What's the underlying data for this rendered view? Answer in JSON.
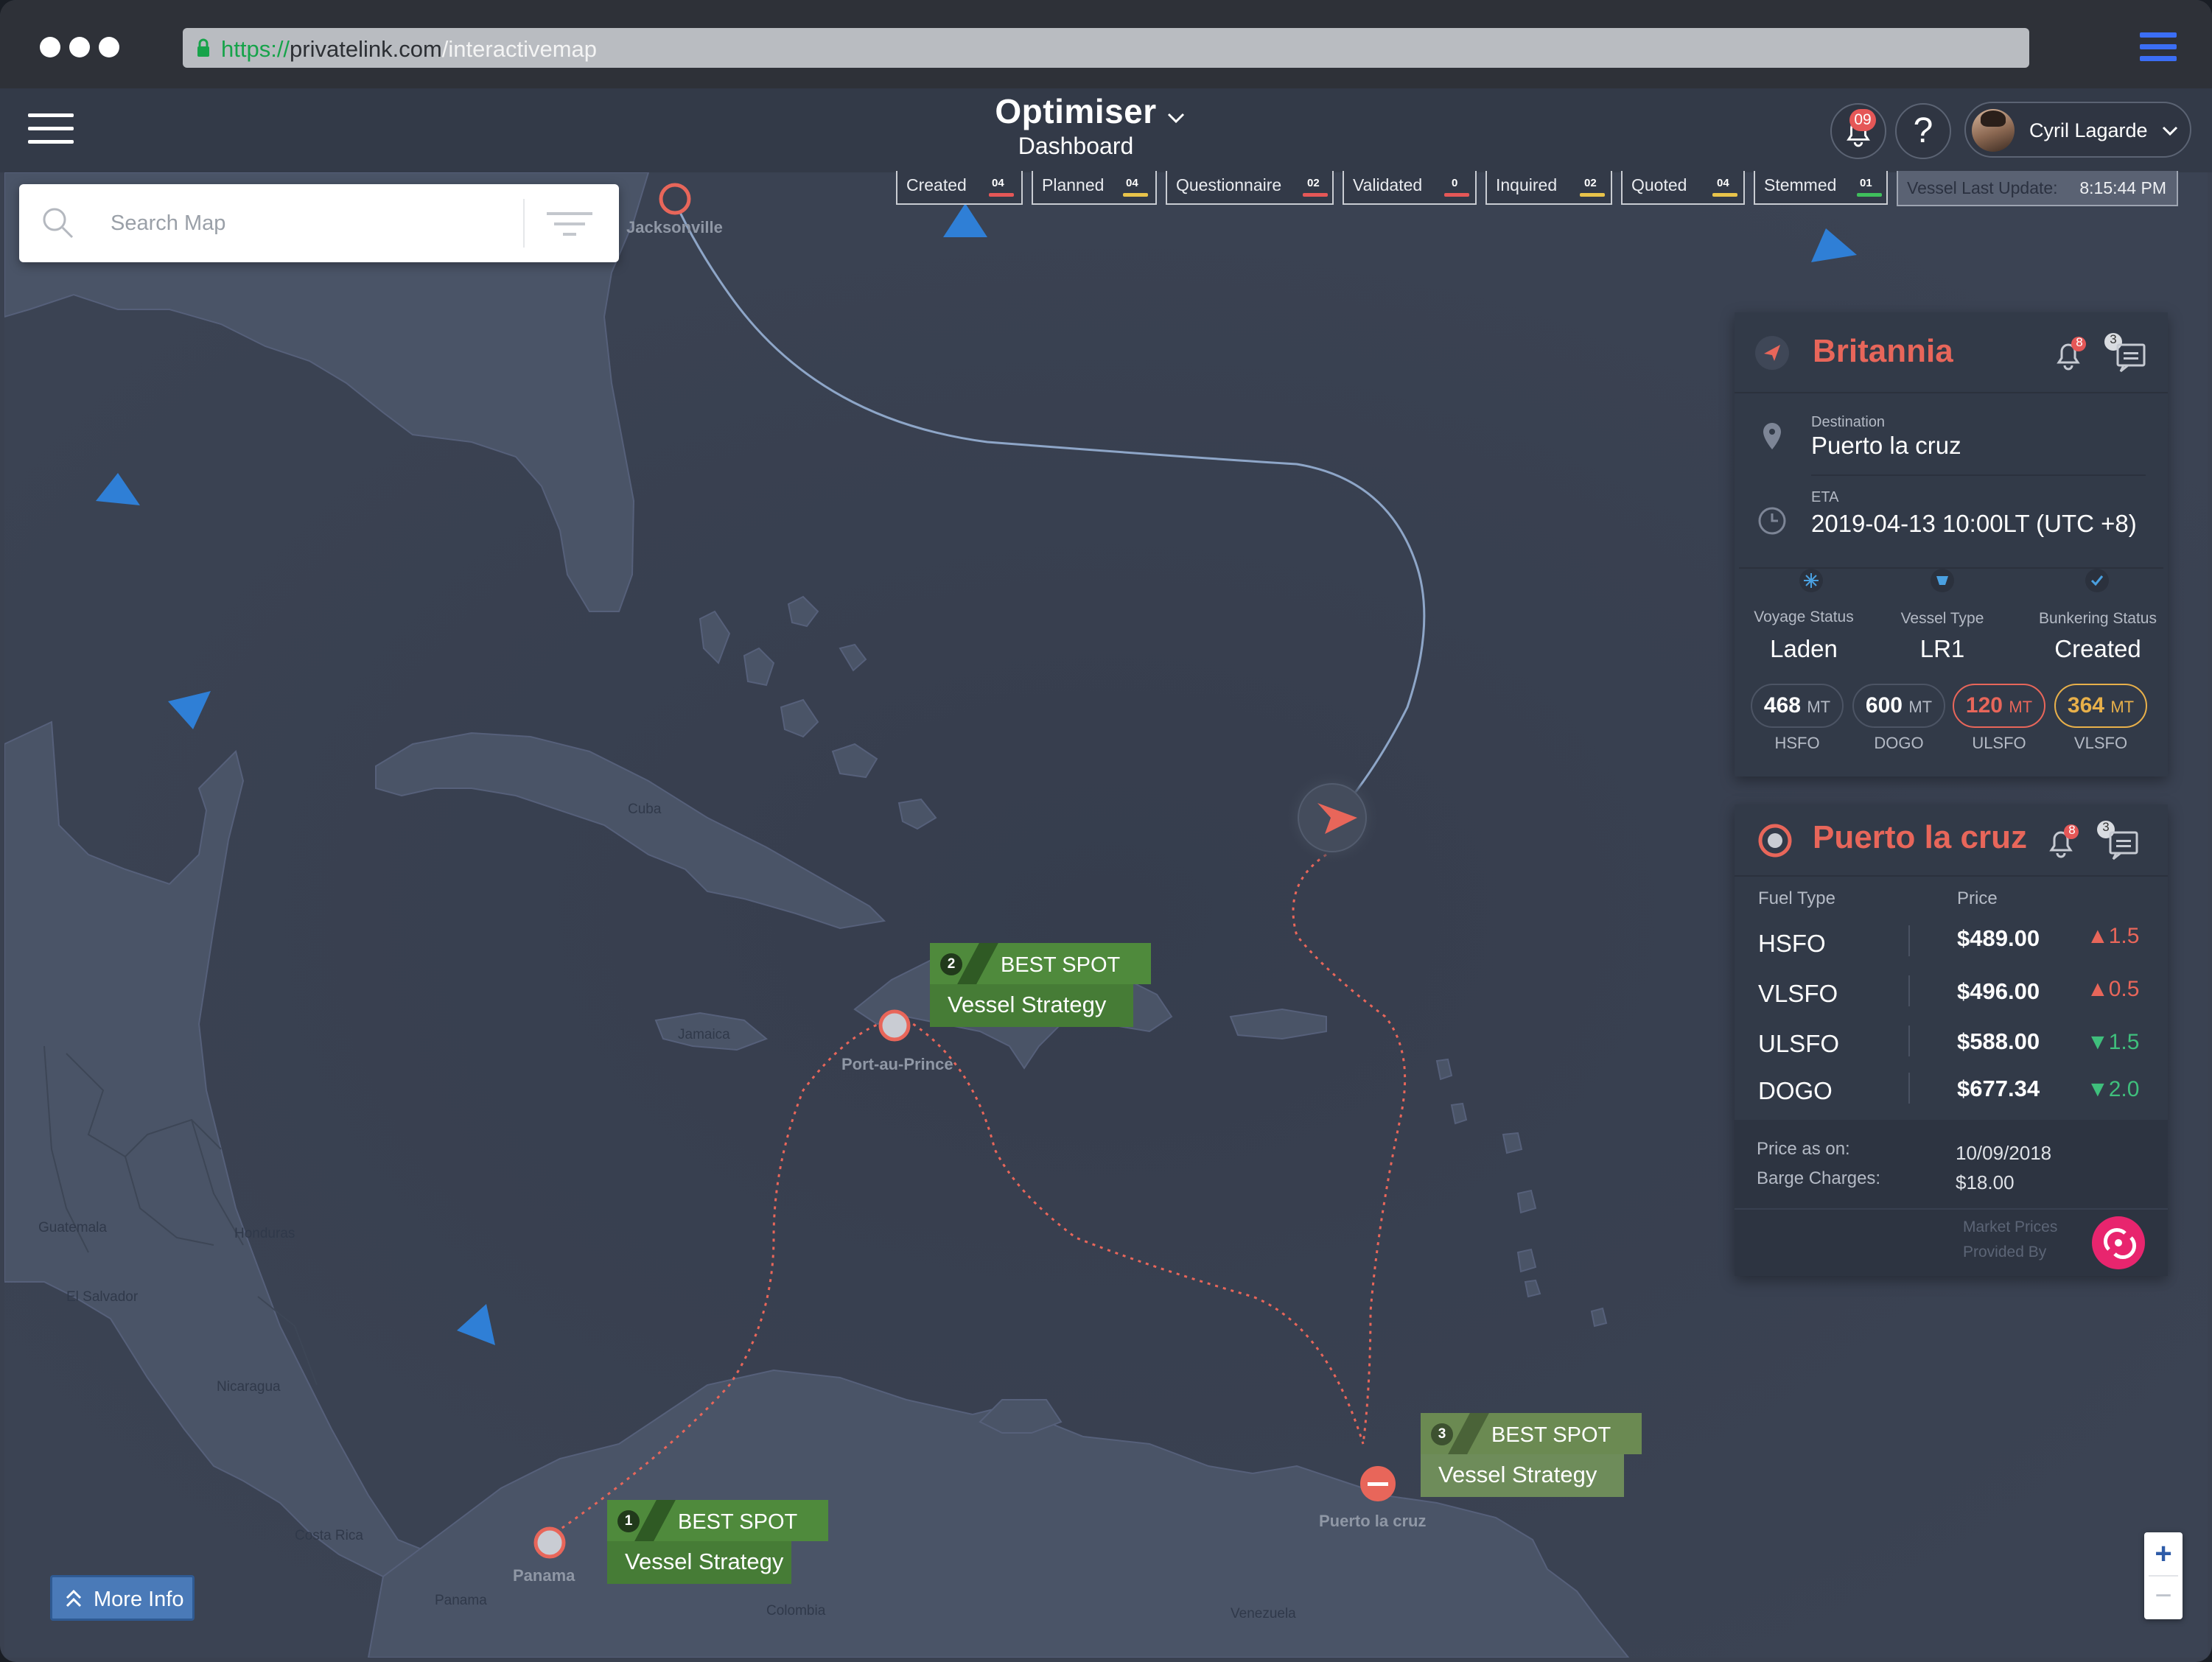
{
  "browser": {
    "url_scheme": "https://",
    "url_host": "privatelink.com",
    "url_path": "/interactivemap"
  },
  "app": {
    "title": "Optimiser",
    "subtitle": "Dashboard",
    "notifications_count": "09",
    "help_label": "?",
    "user_name": "Cyril Lagarde"
  },
  "search": {
    "placeholder": "Search Map"
  },
  "status_tabs": [
    {
      "label": "Created",
      "count": "04",
      "color": "#e55757"
    },
    {
      "label": "Planned",
      "count": "04",
      "color": "#e8c34a"
    },
    {
      "label": "Questionnaire",
      "count": "02",
      "color": "#e55757"
    },
    {
      "label": "Validated",
      "count": "0",
      "color": "#e55757"
    },
    {
      "label": "Inquired",
      "count": "02",
      "color": "#e8c34a"
    },
    {
      "label": "Quoted",
      "count": "04",
      "color": "#e8c34a"
    },
    {
      "label": "Stemmed",
      "count": "01",
      "color": "#3fbf5c"
    }
  ],
  "vessel_update": {
    "label": "Vessel Last Update:",
    "time": "8:15:44 PM"
  },
  "map": {
    "cities": [
      "Jacksonville",
      "Port-au-Prince",
      "Panama",
      "Puerto la cruz"
    ],
    "regions": [
      "Cuba",
      "Jamaica",
      "Guatemala",
      "Honduras",
      "El Salvador",
      "Nicaragua",
      "Costa Rica",
      "Panama",
      "Colombia",
      "Venezuela"
    ]
  },
  "best_spots": [
    {
      "number": "1",
      "title": "BEST SPOT",
      "label": "Vessel Strategy"
    },
    {
      "number": "2",
      "title": "BEST SPOT",
      "label": "Vessel Strategy"
    },
    {
      "number": "3",
      "title": "BEST SPOT",
      "label": "Vessel Strategy"
    }
  ],
  "vessel": {
    "name": "Britannia",
    "alerts": "8",
    "messages": "3",
    "destination_label": "Destination",
    "destination": "Puerto la cruz",
    "eta_label": "ETA",
    "eta": "2019-04-13 10:00LT (UTC +8)",
    "voyage_status_label": "Voyage Status",
    "voyage_status": "Laden",
    "vessel_type_label": "Vessel Type",
    "vessel_type": "LR1",
    "bunkering_status_label": "Bunkering Status",
    "bunkering_status": "Created",
    "fuels": [
      {
        "amount": "468",
        "unit": "MT",
        "name": "HSFO",
        "color": "#ffffff",
        "border": "#4c5464"
      },
      {
        "amount": "600",
        "unit": "MT",
        "name": "DOGO",
        "color": "#ffffff",
        "border": "#4c5464"
      },
      {
        "amount": "120",
        "unit": "MT",
        "name": "ULSFO",
        "color": "#e8665a",
        "border": "#e8665a"
      },
      {
        "amount": "364",
        "unit": "MT",
        "name": "VLSFO",
        "color": "#e8b04a",
        "border": "#e8b04a"
      }
    ]
  },
  "port": {
    "name": "Puerto la cruz",
    "alerts": "8",
    "messages": "3",
    "col_fuel": "Fuel Type",
    "col_price": "Price",
    "prices": [
      {
        "fuel": "HSFO",
        "price": "$489.00",
        "change": "1.5",
        "direction": "up"
      },
      {
        "fuel": "VLSFO",
        "price": "$496.00",
        "change": "0.5",
        "direction": "up"
      },
      {
        "fuel": "ULSFO",
        "price": "$588.00",
        "change": "1.5",
        "direction": "down"
      },
      {
        "fuel": "DOGO",
        "price": "$677.34",
        "change": "2.0",
        "direction": "down"
      }
    ],
    "price_as_on_label": "Price as on:",
    "price_as_on": "10/09/2018",
    "barge_label": "Barge Charges:",
    "barge": "$18.00",
    "provider_line1": "Market Prices",
    "provider_line2": "Provided By"
  },
  "more_info_label": "More Info",
  "zoom": {
    "in": "+",
    "out": "−"
  }
}
